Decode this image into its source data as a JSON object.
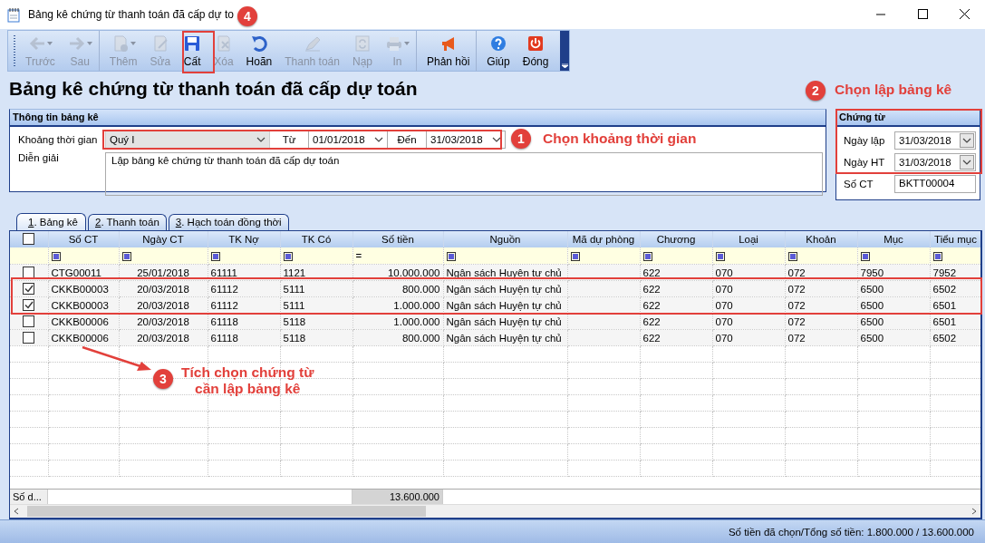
{
  "window": {
    "title": "Bảng kê chứng từ thanh toán đã cấp dự to"
  },
  "toolbar": [
    {
      "label": "Trước",
      "kind": "back",
      "disabled": true,
      "dropdown": true,
      "separator": false
    },
    {
      "label": "Sau",
      "kind": "forward",
      "disabled": true,
      "dropdown": true,
      "separator": true
    },
    {
      "label": "Thêm",
      "kind": "add",
      "disabled": true,
      "dropdown": true,
      "separator": false
    },
    {
      "label": "Sửa",
      "kind": "edit",
      "disabled": true,
      "dropdown": false,
      "separator": false
    },
    {
      "label": "Cất",
      "kind": "save",
      "disabled": false,
      "dropdown": false,
      "separator": false
    },
    {
      "label": "Xóa",
      "kind": "delete",
      "disabled": true,
      "dropdown": false,
      "separator": false
    },
    {
      "label": "Hoãn",
      "kind": "undo",
      "disabled": false,
      "dropdown": false,
      "separator": false
    },
    {
      "label": "Thanh toán",
      "kind": "pen",
      "disabled": true,
      "dropdown": false,
      "separator": false
    },
    {
      "label": "Nạp",
      "kind": "reload",
      "disabled": true,
      "dropdown": false,
      "separator": false
    },
    {
      "label": "In",
      "kind": "print",
      "disabled": true,
      "dropdown": true,
      "separator": true
    },
    {
      "label": "Phản hồi",
      "kind": "megaphone",
      "disabled": false,
      "dropdown": false,
      "separator": true
    },
    {
      "label": "Giúp",
      "kind": "help",
      "disabled": false,
      "dropdown": false,
      "separator": false
    },
    {
      "label": "Đóng",
      "kind": "power",
      "disabled": false,
      "dropdown": false,
      "separator": false
    }
  ],
  "heading": "Bảng kê chứng từ thanh toán đã cấp dự toán",
  "info_panel": {
    "title": "Thông tin bảng kê",
    "period_label": "Khoảng thời gian",
    "period": "Quý I",
    "from_label": "Từ",
    "from": "01/01/2018",
    "to_label": "Đến",
    "to": "31/03/2018",
    "description_label": "Diễn giải",
    "description": "Lập bảng kê chứng từ thanh toán đã cấp dự toán"
  },
  "doc_panel": {
    "title": "Chứng từ",
    "fields": [
      {
        "label": "Ngày lập",
        "value": "31/03/2018",
        "kind": "date"
      },
      {
        "label": "Ngày HT",
        "value": "31/03/2018",
        "kind": "date"
      },
      {
        "label": "Số CT",
        "value": "BKTT00004",
        "kind": "text"
      }
    ]
  },
  "tabs": [
    {
      "label": "1. Bảng kê",
      "selected": true
    },
    {
      "label": "2. Thanh toán",
      "selected": false
    },
    {
      "label": "3. Hạch toán đồng thời",
      "selected": false
    }
  ],
  "grid": {
    "select_all": false,
    "columns": [
      {
        "label": "Số CT",
        "kind": "text"
      },
      {
        "label": "Ngày CT",
        "kind": "date"
      },
      {
        "label": "TK Nợ",
        "kind": "text"
      },
      {
        "label": "TK Có",
        "kind": "text"
      },
      {
        "label": "Số tiền",
        "kind": "money"
      },
      {
        "label": "Nguồn",
        "kind": "text"
      },
      {
        "label": "Mã dự phòng",
        "kind": "text"
      },
      {
        "label": "Chương",
        "kind": "text"
      },
      {
        "label": "Loại",
        "kind": "text"
      },
      {
        "label": "Khoản",
        "kind": "text"
      },
      {
        "label": "Mục",
        "kind": "text"
      },
      {
        "label": "Tiểu mục",
        "kind": "text"
      }
    ],
    "filters": [
      {
        "kind": "box"
      },
      {
        "kind": "box"
      },
      {
        "kind": "box"
      },
      {
        "kind": "box"
      },
      {
        "kind": "operator",
        "text": "="
      },
      {
        "kind": "box"
      },
      {
        "kind": "box"
      },
      {
        "kind": "box"
      },
      {
        "kind": "box"
      },
      {
        "kind": "box"
      },
      {
        "kind": "box"
      },
      {
        "kind": "box"
      }
    ],
    "rows": [
      {
        "checked": false,
        "cells": [
          "CTG00011",
          "25/01/2018",
          "61111",
          "1121",
          "10.000.000",
          "Ngân sách Huyện tự chủ",
          "",
          "622",
          "070",
          "072",
          "7950",
          "7952"
        ]
      },
      {
        "checked": true,
        "cells": [
          "CKKB00003",
          "20/03/2018",
          "61112",
          "5111",
          "800.000",
          "Ngân sách Huyện tự chủ",
          "",
          "622",
          "070",
          "072",
          "6500",
          "6502"
        ]
      },
      {
        "checked": true,
        "cells": [
          "CKKB00003",
          "20/03/2018",
          "61112",
          "5111",
          "1.000.000",
          "Ngân sách Huyện tự chủ",
          "",
          "622",
          "070",
          "072",
          "6500",
          "6501"
        ]
      },
      {
        "checked": false,
        "cells": [
          "CKKB00006",
          "20/03/2018",
          "61118",
          "5118",
          "1.000.000",
          "Ngân sách Huyện tự chủ",
          "",
          "622",
          "070",
          "072",
          "6500",
          "6501"
        ]
      },
      {
        "checked": false,
        "cells": [
          "CKKB00006",
          "20/03/2018",
          "61118",
          "5118",
          "800.000",
          "Ngân sách Huyện tự chủ",
          "",
          "622",
          "070",
          "072",
          "6500",
          "6502"
        ]
      }
    ],
    "footer": {
      "label": "Số d...",
      "total": "13.600.000"
    }
  },
  "status_bar": {
    "text": "Số tiền đã chọn/Tổng số tiền: 1.800.000 / 13.600.000"
  },
  "annotations": [
    {
      "number": "4"
    },
    {
      "number": "2",
      "lines": [
        "Chọn lập bảng kê"
      ]
    },
    {
      "number": "1",
      "lines": [
        "Chọn khoảng thời gian"
      ]
    },
    {
      "number": "3",
      "lines": [
        "Tích chọn chứng từ",
        "cần lập bảng kê"
      ]
    }
  ]
}
